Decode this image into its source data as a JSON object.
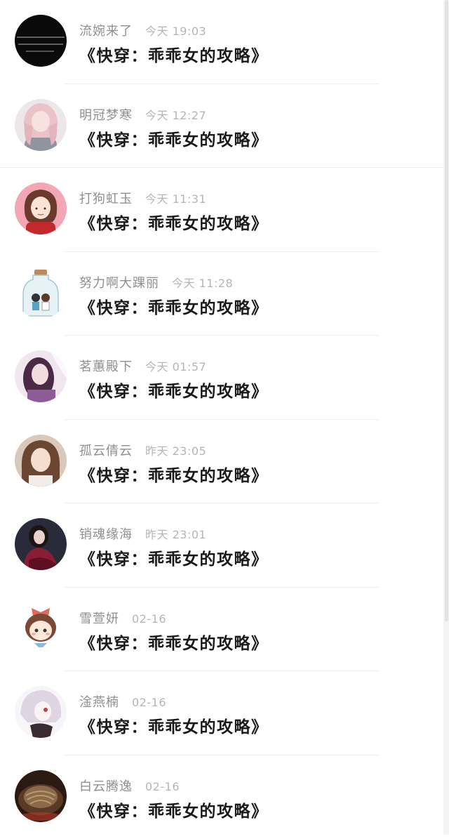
{
  "comments": [
    {
      "user": "流婉来了",
      "time": "今天 19:03",
      "text": "《快穿：乖乖女的攻略》",
      "avatar_icon": "dark-text-avatar-icon"
    },
    {
      "user": "明冠梦寒",
      "time": "今天 12:27",
      "text": "《快穿：乖乖女的攻略》",
      "avatar_icon": "girl-pink-hair-avatar-icon"
    },
    {
      "user": "打狗虹玉",
      "time": "今天 11:31",
      "text": "《快穿：乖乖女的攻略》",
      "avatar_icon": "cartoon-girl-pink-avatar-icon"
    },
    {
      "user": "努力啊大踝丽",
      "time": "今天 11:28",
      "text": "《快穿：乖乖女的攻略》",
      "avatar_icon": "bottle-couple-avatar-icon"
    },
    {
      "user": "茗蕙殿下",
      "time": "今天 01:57",
      "text": "《快穿：乖乖女的攻略》",
      "avatar_icon": "girl-purple-avatar-icon"
    },
    {
      "user": "孤云倩云",
      "time": "昨天 23:05",
      "text": "《快穿：乖乖女的攻略》",
      "avatar_icon": "girl-brown-hair-avatar-icon"
    },
    {
      "user": "销魂缘海",
      "time": "昨天 23:01",
      "text": "《快穿：乖乖女的攻略》",
      "avatar_icon": "girl-red-dress-avatar-icon"
    },
    {
      "user": "雪萱妍",
      "time": "02-16",
      "text": "《快穿：乖乖女的攻略》",
      "avatar_icon": "cartoon-girl-bow-avatar-icon"
    },
    {
      "user": "淦燕楠",
      "time": "02-16",
      "text": "《快穿：乖乖女的攻略》",
      "avatar_icon": "anime-white-hair-avatar-icon"
    },
    {
      "user": "白云腾逸",
      "time": "02-16",
      "text": "《快穿：乖乖女的攻略》",
      "avatar_icon": "noodles-food-avatar-icon"
    }
  ]
}
